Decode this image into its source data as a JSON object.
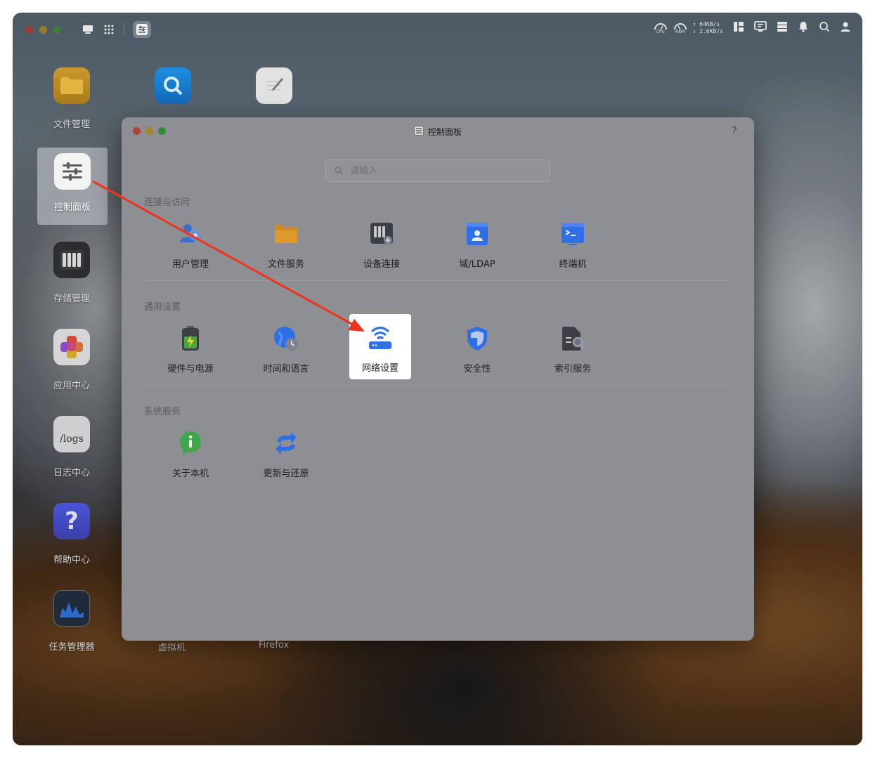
{
  "desktop": {
    "icons": [
      {
        "label": "文件管理"
      },
      {
        "label": "控制面板"
      },
      {
        "label": "存储管理"
      },
      {
        "label": "应用中心"
      },
      {
        "label": "日志中心",
        "tile_text": "/logs"
      },
      {
        "label": "帮助中心",
        "tile_text": "?"
      },
      {
        "label": "任务管理器"
      }
    ],
    "bottom_labels": [
      "虚拟机",
      "Firefox"
    ]
  },
  "topbar": {
    "cpu_label": "CPU",
    "ram_label": "RAM",
    "upload": "↑ 64KB/s",
    "download": "↓ 2.6KB/s"
  },
  "window": {
    "title": "控制面板",
    "help": "?",
    "search_placeholder": "请输入",
    "sections": [
      {
        "title": "连接与访问",
        "items": [
          {
            "label": "用户管理"
          },
          {
            "label": "文件服务"
          },
          {
            "label": "设备连接"
          },
          {
            "label": "域/LDAP"
          },
          {
            "label": "终端机"
          }
        ]
      },
      {
        "title": "通用设置",
        "items": [
          {
            "label": "硬件与电源"
          },
          {
            "label": "时间和语言"
          },
          {
            "label": "网络设置"
          },
          {
            "label": "安全性"
          },
          {
            "label": "索引服务"
          }
        ]
      },
      {
        "title": "系统服务",
        "items": [
          {
            "label": "关于本机"
          },
          {
            "label": "更新与还原"
          }
        ]
      }
    ]
  },
  "colors": {
    "annotation_arrow": "#f0321e",
    "highlight_bg": "#ffffff",
    "accent_blue": "#2f6fe6"
  }
}
